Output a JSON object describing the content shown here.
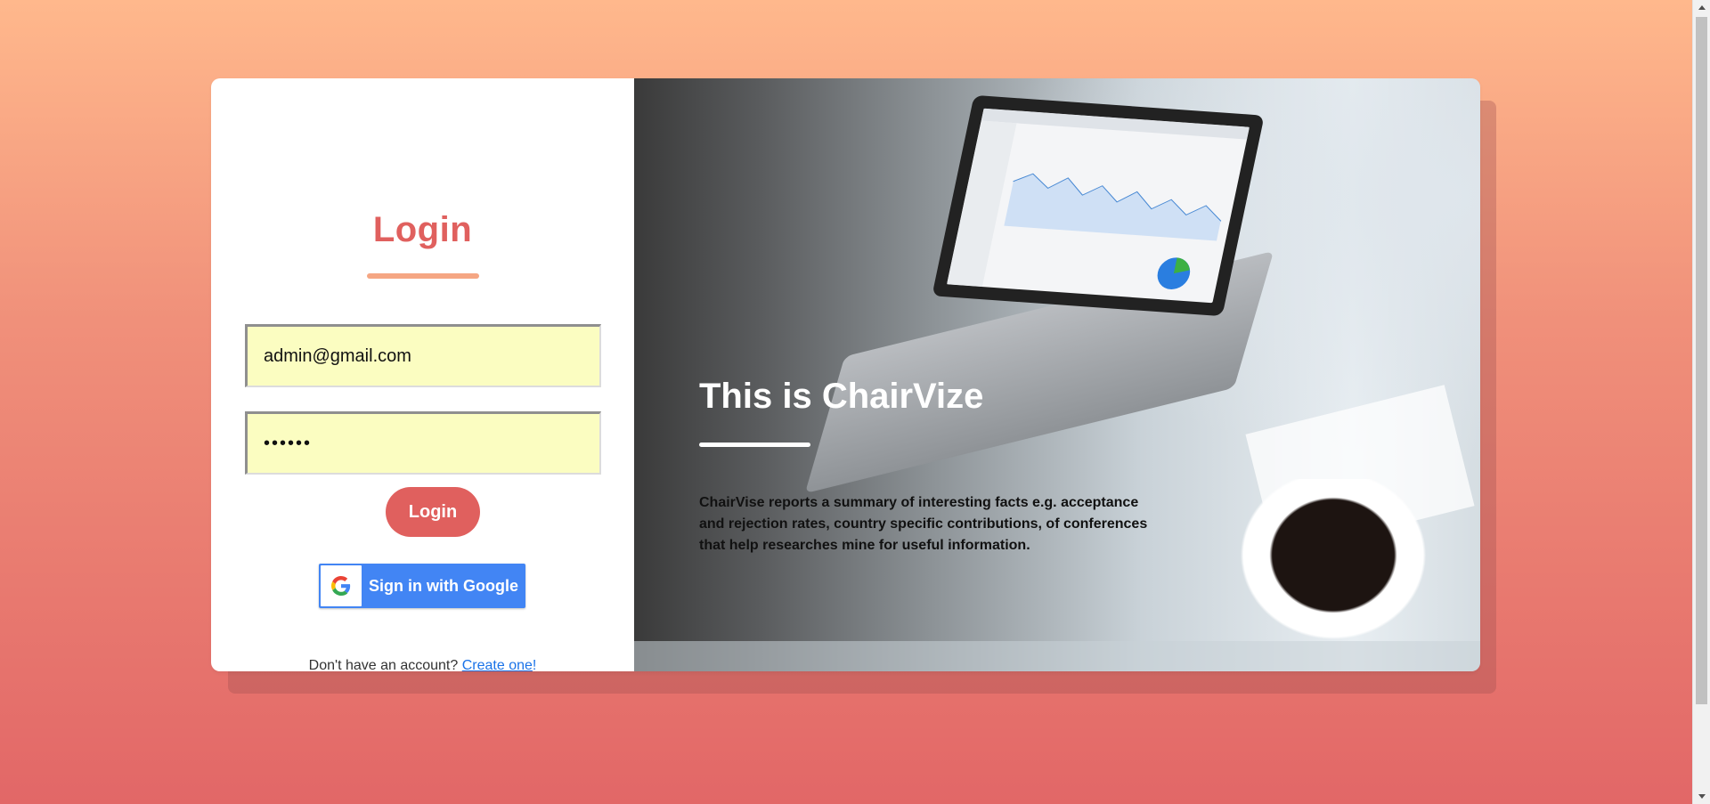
{
  "login": {
    "title": "Login",
    "email_value": "admin@gmail.com",
    "password_value": "••••••",
    "login_button": "Login",
    "google_button": "Sign in with Google",
    "signup_prompt": "Don't have an account? ",
    "signup_link": "Create one",
    "signup_suffix": "!"
  },
  "hero": {
    "title": "This is ChairVize",
    "description": "ChairVise reports a summary of interesting facts e.g. acceptance and rejection rates, country specific contributions, of conferences that help researches mine for useful information."
  },
  "colors": {
    "accent": "#e0605e",
    "underline": "#f5a683",
    "input_bg": "#fbfdc1",
    "google_blue": "#4285f4",
    "link": "#1a73e8"
  }
}
